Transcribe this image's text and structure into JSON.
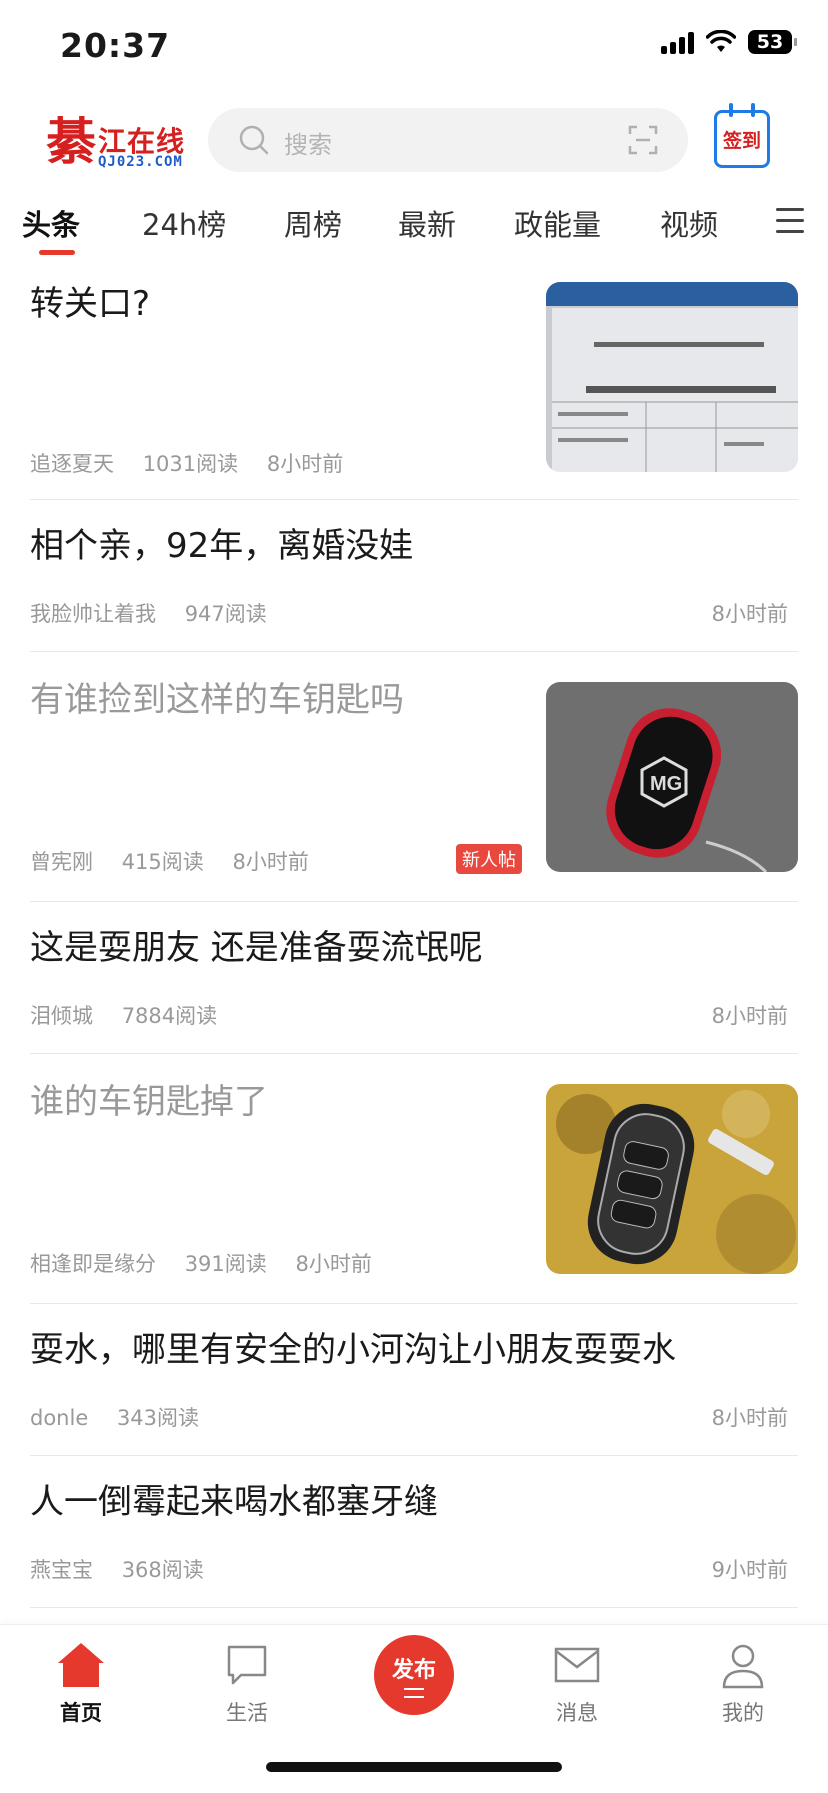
{
  "status_bar": {
    "time": "20:37",
    "battery": "53"
  },
  "header": {
    "logo": {
      "glyph": "綦",
      "name": "江在线",
      "domain": "QJ023.COM"
    },
    "search": {
      "placeholder": "搜索"
    },
    "checkin_label": "签到"
  },
  "tabs": [
    "头条",
    "24h榜",
    "周榜",
    "最新",
    "政能量",
    "视频"
  ],
  "active_tab": "头条",
  "posts": [
    {
      "title": "转关口?",
      "author": "追逐夏天",
      "reads": "1031阅读",
      "time": "8小时前",
      "has_image": true,
      "image": "document-photo"
    },
    {
      "title": "相个亲，92年，离婚没娃",
      "author": "我脸帅让着我",
      "reads": "947阅读",
      "time": "8小时前",
      "has_image": false
    },
    {
      "title": "有谁捡到这样的车钥匙吗",
      "author": "曾宪刚",
      "reads": "415阅读",
      "time": "8小时前",
      "has_image": true,
      "image": "car-key-mg-photo",
      "badge": "新人帖",
      "read": true
    },
    {
      "title": "这是耍朋友 还是准备耍流氓呢",
      "author": "泪倾城",
      "reads": "7884阅读",
      "time": "8小时前",
      "has_image": false
    },
    {
      "title": "谁的车钥匙掉了",
      "author": "相逢即是缘分",
      "reads": "391阅读",
      "time": "8小时前",
      "has_image": true,
      "image": "car-key-ground-photo",
      "read": true
    },
    {
      "title": "耍水，哪里有安全的小河沟让小朋友耍耍水",
      "author": "donle",
      "reads": "343阅读",
      "time": "8小时前",
      "has_image": false
    },
    {
      "title": "人一倒霉起来喝水都塞牙缝",
      "author": "燕宝宝",
      "reads": "368阅读",
      "time": "9小时前",
      "has_image": false
    }
  ],
  "bottom_nav": {
    "home": "首页",
    "life": "生活",
    "publish": "发布",
    "messages": "消息",
    "me": "我的"
  },
  "colors": {
    "accent": "#e4392c",
    "checkin_blue": "#1e7be6",
    "meta_gray": "#999999"
  }
}
